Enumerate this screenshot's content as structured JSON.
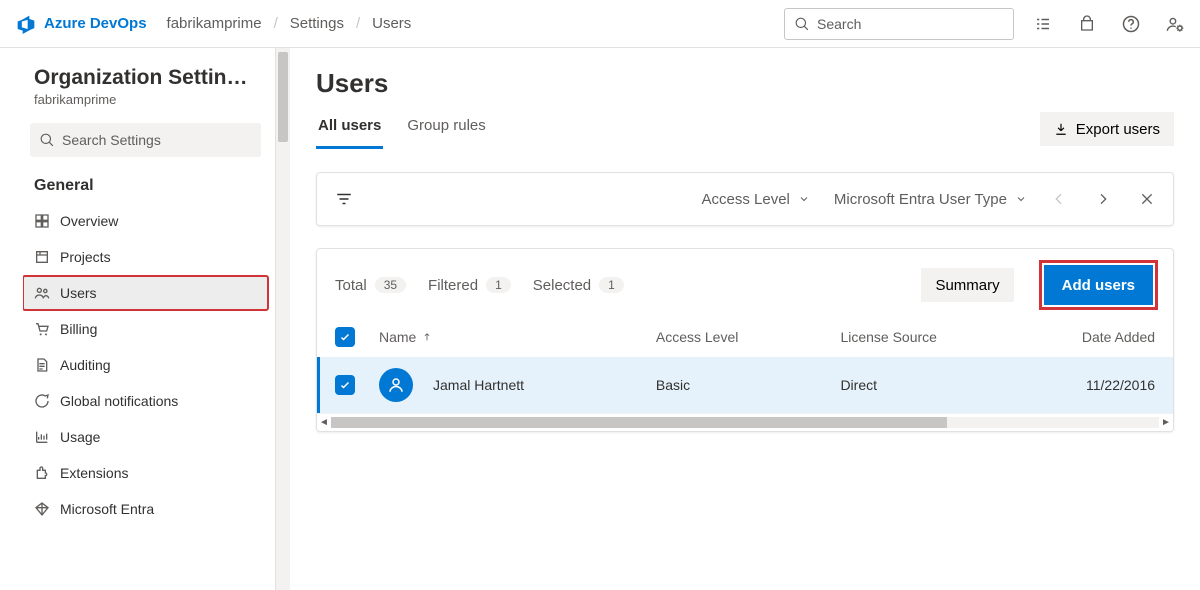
{
  "header": {
    "brand": "Azure DevOps",
    "crumbs": [
      "fabrikamprime",
      "Settings",
      "Users"
    ],
    "search_placeholder": "Search"
  },
  "sidebar": {
    "title": "Organization Settin…",
    "org": "fabrikamprime",
    "search_placeholder": "Search Settings",
    "heading": "General",
    "items": [
      {
        "label": "Overview"
      },
      {
        "label": "Projects"
      },
      {
        "label": "Users"
      },
      {
        "label": "Billing"
      },
      {
        "label": "Auditing"
      },
      {
        "label": "Global notifications"
      },
      {
        "label": "Usage"
      },
      {
        "label": "Extensions"
      },
      {
        "label": "Microsoft Entra"
      }
    ]
  },
  "page": {
    "title": "Users",
    "tabs": {
      "active": "All users",
      "other": "Group rules"
    },
    "export_label": "Export users",
    "filters": {
      "access": "Access Level",
      "entra": "Microsoft Entra User Type"
    },
    "stats": {
      "total_label": "Total",
      "total_count": "35",
      "filtered_label": "Filtered",
      "filtered_count": "1",
      "selected_label": "Selected",
      "selected_count": "1"
    },
    "summary_label": "Summary",
    "add_label": "Add users",
    "columns": {
      "name": "Name",
      "access": "Access Level",
      "source": "License Source",
      "date": "Date Added"
    },
    "rows": [
      {
        "name": "Jamal Hartnett",
        "access": "Basic",
        "source": "Direct",
        "date": "11/22/2016"
      }
    ]
  }
}
